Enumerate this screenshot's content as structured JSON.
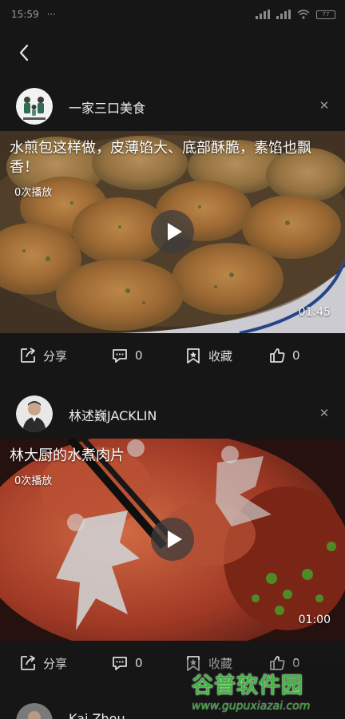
{
  "status_bar": {
    "time": "15:59",
    "dots": "···",
    "battery": "77"
  },
  "feed": [
    {
      "channel": "一家三口美食",
      "title": "水煎包这样做，皮薄馅大、底部酥脆，素馅也飘香！",
      "plays": "0次播放",
      "duration": "01:45",
      "share_label": "分享",
      "comments": "0",
      "fav_label": "收藏",
      "likes": "0"
    },
    {
      "channel": "林述巍JACKLIN",
      "title": "林大厨的水煮肉片",
      "plays": "0次播放",
      "duration": "01:00",
      "share_label": "分享",
      "comments": "0",
      "fav_label": "收藏",
      "likes": "0"
    },
    {
      "channel": "Kai Zhou"
    }
  ],
  "watermark": {
    "brand": "谷普软件园",
    "url": "www.gupuxiazai.com"
  },
  "icons": [
    "back-arrow-icon",
    "close-icon",
    "play-icon",
    "share-icon",
    "comment-icon",
    "bookmark-icon",
    "thumbs-up-icon"
  ]
}
